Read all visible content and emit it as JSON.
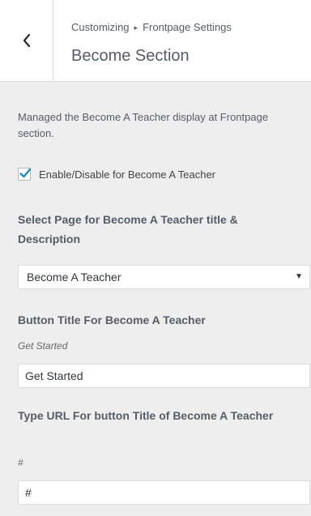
{
  "header": {
    "breadcrumb_root": "Customizing",
    "breadcrumb_separator": "▸",
    "breadcrumb_parent": "Frontpage Settings",
    "title": "Become Section"
  },
  "section": {
    "description": "Managed the Become A Teacher display at Frontpage section.",
    "enable_checkbox": {
      "label": "Enable/Disable for Become A Teacher",
      "checked": true
    },
    "page_select": {
      "label": "Select Page for Become A Teacher title & Description",
      "value": "Become A Teacher"
    },
    "button_title": {
      "label": "Button Title For Become A Teacher",
      "placeholder_hint": "Get Started",
      "value": "Get Started"
    },
    "button_url": {
      "label": "Type URL For button Title of Become A Teacher",
      "placeholder_hint": "#",
      "value": "#"
    }
  },
  "colors": {
    "checkmark": "#1e8cbe",
    "background": "#eeeeee",
    "text": "#555d66"
  },
  "icons": {
    "back": "chevron-left-icon",
    "checkmark": "checkmark-icon",
    "select_arrow": "triangle-down-icon"
  }
}
